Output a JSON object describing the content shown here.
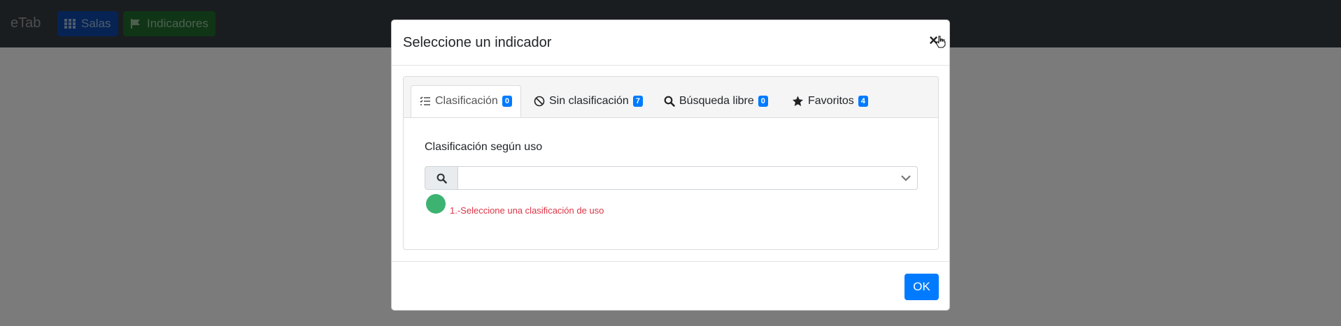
{
  "navbar": {
    "brand": "eTab",
    "buttons": [
      {
        "label": "Salas",
        "icon": "grid-icon"
      },
      {
        "label": "Indicadores",
        "icon": "flag-icon"
      }
    ]
  },
  "modal": {
    "title": "Seleccione un indicador",
    "close_label": "×",
    "tabs": [
      {
        "label": "Clasificación",
        "count": "0",
        "icon": "checklist-icon",
        "active": true
      },
      {
        "label": "Sin clasificación",
        "count": "7",
        "icon": "ban-icon",
        "active": false
      },
      {
        "label": "Búsqueda libre",
        "count": "0",
        "icon": "search-icon",
        "active": false
      },
      {
        "label": "Favoritos",
        "count": "4",
        "icon": "star-icon",
        "active": false
      }
    ],
    "section_label": "Clasificación según uso",
    "select_value": "",
    "hint": "1.-Seleccione una clasificación de uso",
    "ok_label": "OK"
  },
  "colors": {
    "primary": "#007bff",
    "status_green": "#3cb371",
    "hint_red": "#dc3545"
  }
}
